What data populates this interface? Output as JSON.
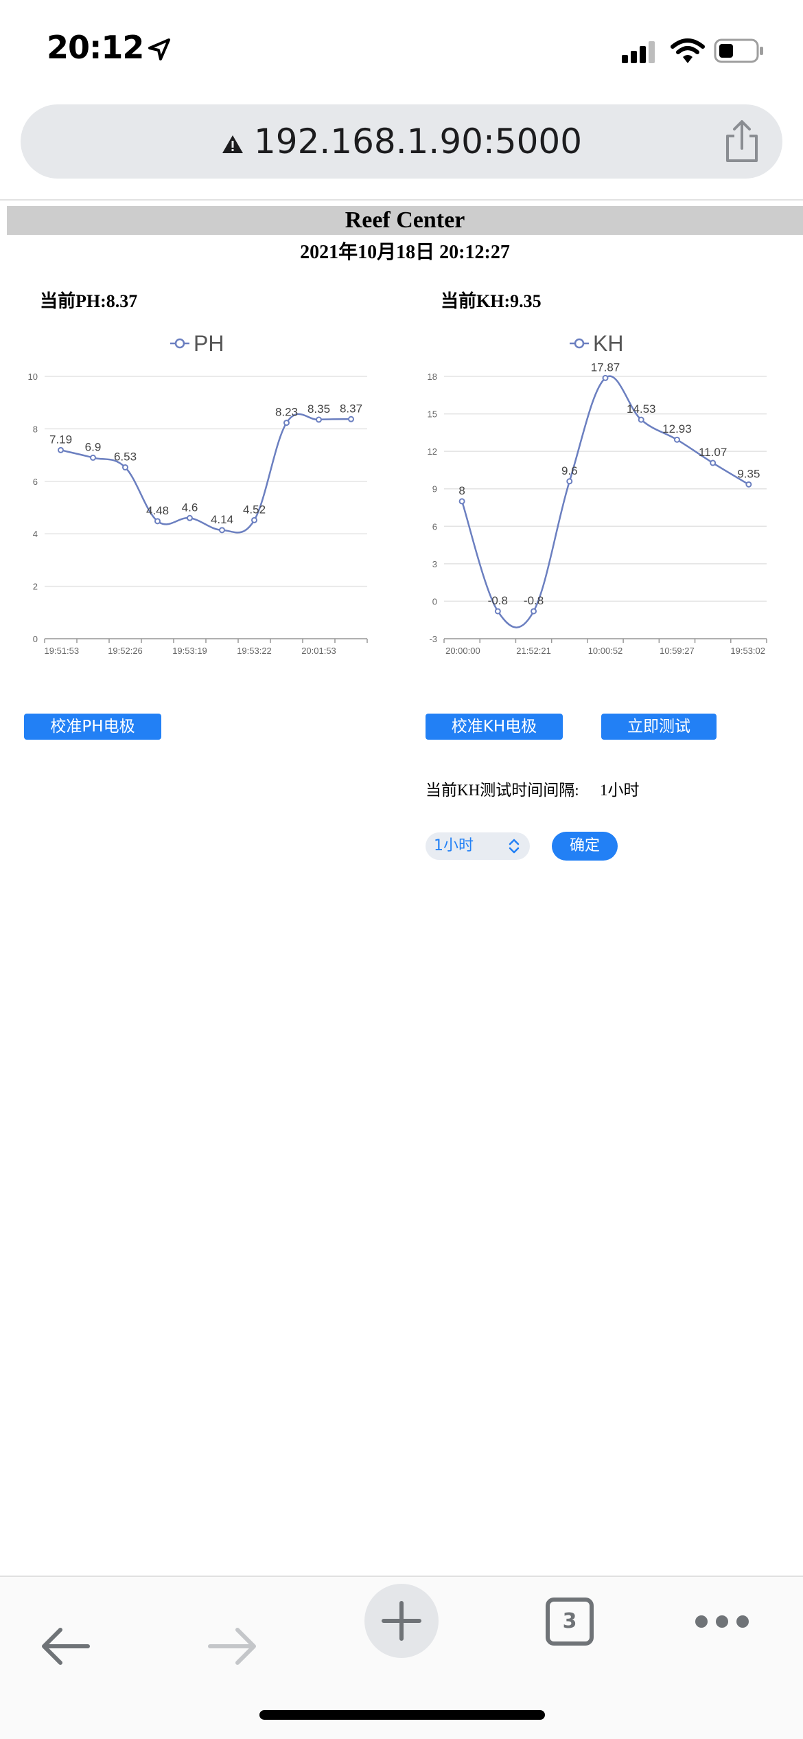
{
  "status_bar": {
    "time": "20:12"
  },
  "browser": {
    "url": "192.168.1.90:5000",
    "tab_count": "3"
  },
  "page": {
    "title": "Reef Center",
    "datetime": "2021年10月18日  20:12:27",
    "ph_reading": "当前PH:8.37",
    "kh_reading": "当前KH:9.35",
    "calibrate_ph_label": "校准PH电极",
    "calibrate_kh_label": "校准KH电极",
    "test_now_label": "立即测试",
    "interval_label": "当前KH测试时间间隔:",
    "interval_value": "1小时",
    "interval_select_value": "1小时",
    "confirm_label": "确定"
  },
  "colors": {
    "series": "#6b7fc0",
    "button": "#2280f5",
    "grid": "#e3e3e3"
  },
  "chart_data": [
    {
      "type": "line",
      "x": [
        "19:51:53",
        "",
        "19:52:26",
        "",
        "19:53:19",
        "",
        "19:53:22",
        "",
        "20:01:53",
        ""
      ],
      "x_tick_labels": [
        "19:51:53",
        "19:52:26",
        "19:53:19",
        "19:53:22",
        "20:01:53"
      ],
      "series": [
        {
          "name": "PH",
          "values": [
            7.19,
            6.9,
            6.53,
            4.48,
            4.6,
            4.14,
            4.52,
            8.23,
            8.35,
            8.37
          ]
        }
      ],
      "y_ticks": [
        0,
        2,
        4,
        6,
        8,
        10
      ],
      "ylim": [
        0,
        10
      ],
      "legend": "top-center",
      "grid": true,
      "smooth": true
    },
    {
      "type": "line",
      "x": [
        "20:00:00",
        "",
        "21:52:21",
        "",
        "10:00:52",
        "",
        "10:59:27",
        "",
        "19:53:02"
      ],
      "x_tick_labels": [
        "20:00:00",
        "21:52:21",
        "10:00:52",
        "10:59:27",
        "19:53:02"
      ],
      "series": [
        {
          "name": "KH",
          "values": [
            8,
            -0.8,
            -0.8,
            9.6,
            17.87,
            14.53,
            12.93,
            11.07,
            9.35
          ]
        }
      ],
      "y_ticks": [
        -3,
        0,
        3,
        6,
        9,
        12,
        15,
        18
      ],
      "ylim": [
        -3,
        18
      ],
      "legend": "top-center",
      "grid": true,
      "smooth": true
    }
  ]
}
